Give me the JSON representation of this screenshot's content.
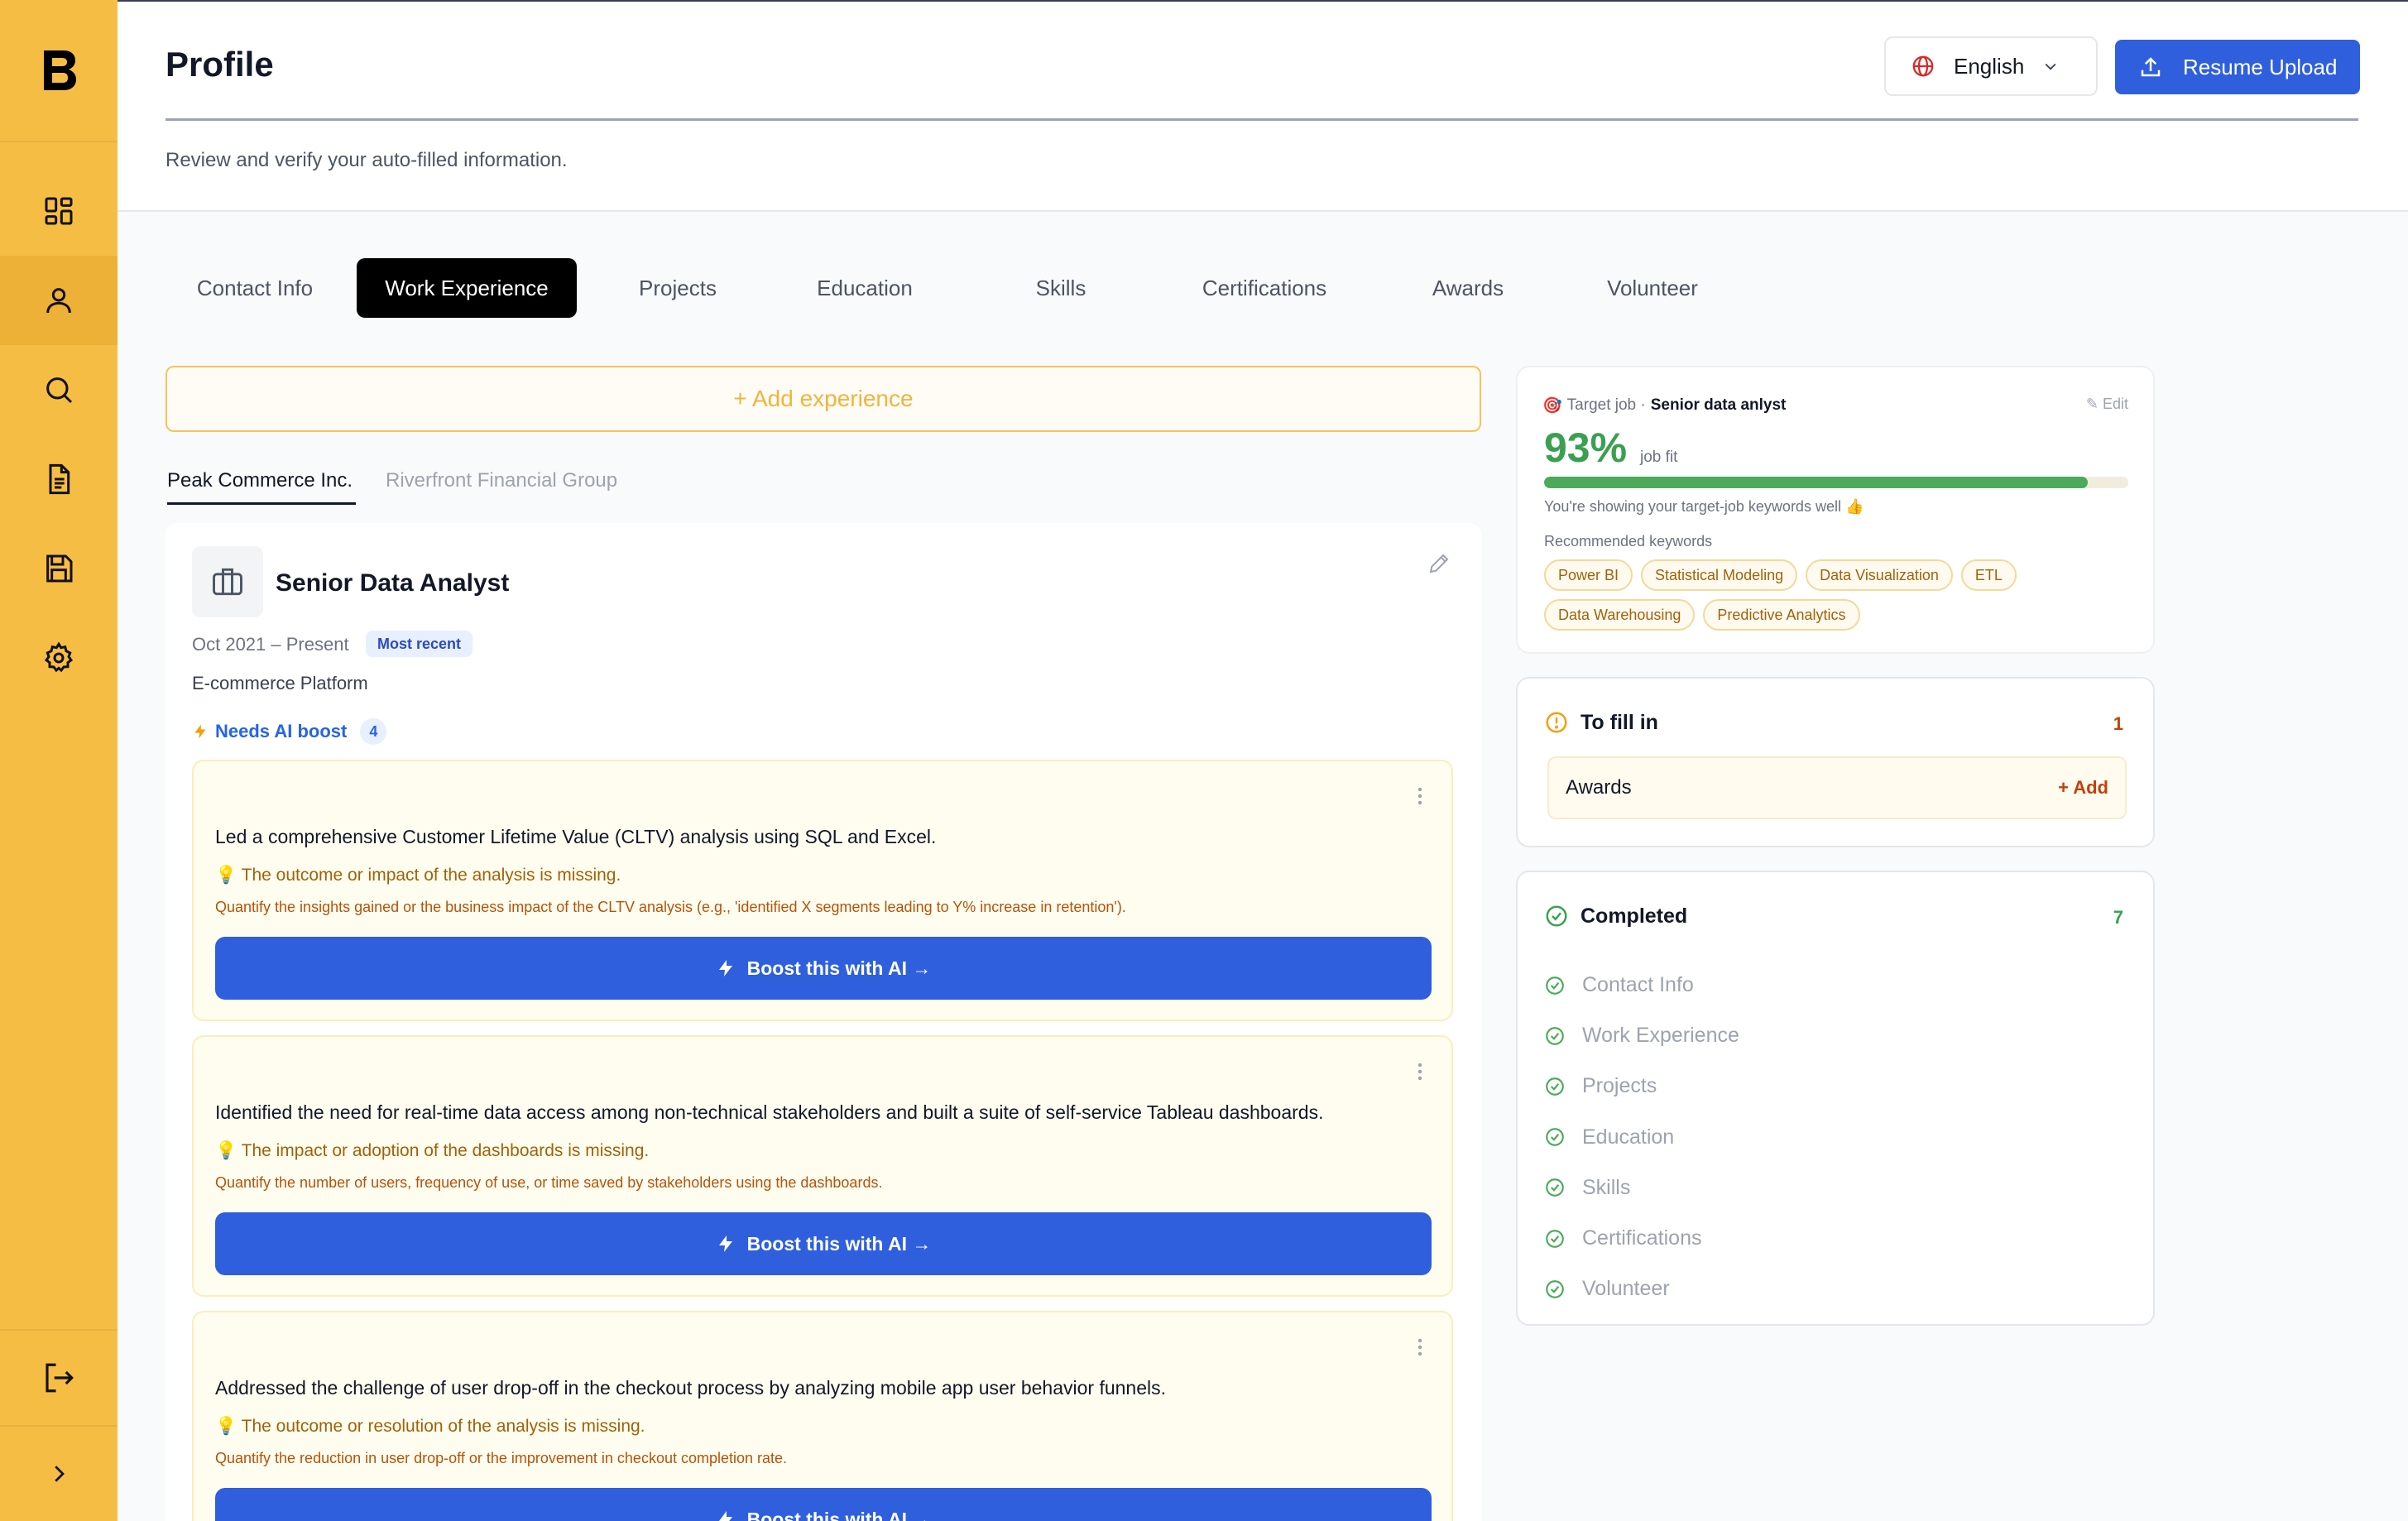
{
  "header": {
    "title": "Profile",
    "subtitle": "Review and verify your auto-filled information.",
    "language": "English",
    "upload_label": "Resume Upload"
  },
  "sidebar": {
    "logo": "B",
    "items": [
      {
        "icon": "dashboard-icon"
      },
      {
        "icon": "user-icon",
        "active": true
      },
      {
        "icon": "search-icon"
      },
      {
        "icon": "document-icon"
      },
      {
        "icon": "save-icon"
      },
      {
        "icon": "gear-icon"
      }
    ],
    "bottom": [
      {
        "icon": "logout-icon"
      },
      {
        "icon": "chevron-right-icon"
      }
    ]
  },
  "tabs": [
    {
      "label": "Contact Info",
      "active": false
    },
    {
      "label": "Work Experience",
      "active": true
    },
    {
      "label": "Projects",
      "active": false
    },
    {
      "label": "Education",
      "active": false
    },
    {
      "label": "Skills",
      "active": false
    },
    {
      "label": "Certifications",
      "active": false
    },
    {
      "label": "Awards",
      "active": false
    },
    {
      "label": "Volunteer",
      "active": false
    }
  ],
  "main": {
    "add_experience": "+ Add experience",
    "companies": [
      {
        "name": "Peak Commerce Inc.",
        "active": true
      },
      {
        "name": "Riverfront Financial Group",
        "active": false
      }
    ],
    "role": {
      "title": "Senior Data Analyst",
      "dates": "Oct 2021 – Present",
      "badge": "Most recent",
      "company_type": "E-commerce Platform",
      "boost_label": "Needs AI boost",
      "boost_count": "4"
    },
    "items": [
      {
        "text": "Led a comprehensive Customer Lifetime Value (CLTV) analysis using SQL and Excel.",
        "issue": "The outcome or impact of the analysis is missing.",
        "hint": "Quantify the insights gained or the business impact of the CLTV analysis (e.g., 'identified X segments leading to Y% increase in retention').",
        "button": "Boost this with AI →"
      },
      {
        "text": "Identified the need for real-time data access among non-technical stakeholders and built a suite of self-service Tableau dashboards.",
        "issue": "The impact or adoption of the dashboards is missing.",
        "hint": "Quantify the number of users, frequency of use, or time saved by stakeholders using the dashboards.",
        "button": "Boost this with AI →"
      },
      {
        "text": "Addressed the challenge of user drop-off in the checkout process by analyzing mobile app user behavior funnels.",
        "issue": "The outcome or resolution of the analysis is missing.",
        "hint": "Quantify the reduction in user drop-off or the improvement in checkout completion rate.",
        "button": "Boost this with AI →"
      }
    ]
  },
  "target": {
    "label": "Target job ·",
    "job": "Senior data anlyst",
    "edit": "✎ Edit",
    "percent": "93%",
    "fit_value": 0.93,
    "fit_label": "job fit",
    "message": "You're showing your target-job keywords well 👍",
    "keywords_label": "Recommended keywords",
    "keywords": [
      "Power BI",
      "Statistical Modeling",
      "Data Visualization",
      "ETL",
      "Data Warehousing",
      "Predictive Analytics"
    ]
  },
  "to_fill": {
    "title": "To fill in",
    "count": "1",
    "items": [
      {
        "label": "Awards",
        "action": "+ Add"
      }
    ]
  },
  "completed": {
    "title": "Completed",
    "count": "7",
    "items": [
      "Contact Info",
      "Work Experience",
      "Projects",
      "Education",
      "Skills",
      "Certifications",
      "Volunteer"
    ]
  },
  "colors": {
    "sidebar": "#f6bd45",
    "primary": "#2f5fdc",
    "success": "#3aa050",
    "warning": "#f59e0b"
  }
}
